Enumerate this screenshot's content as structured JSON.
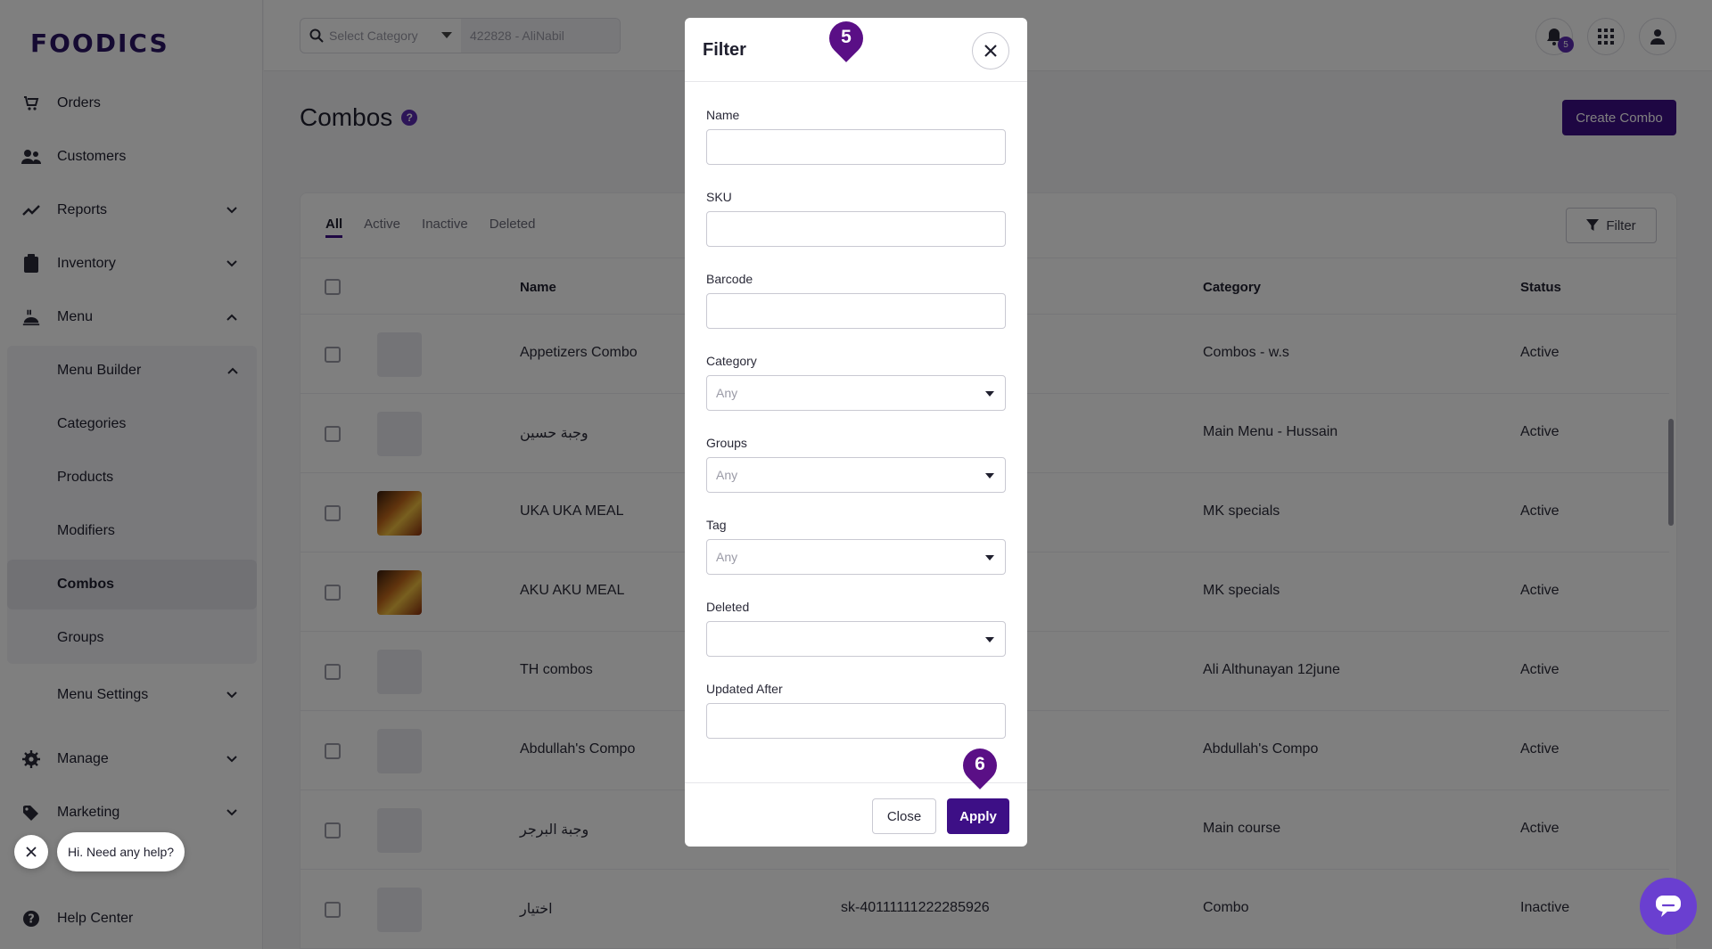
{
  "app": {
    "logo": "FOODICS"
  },
  "sidebar": {
    "items": [
      {
        "label": "Orders",
        "icon": "cart-icon"
      },
      {
        "label": "Customers",
        "icon": "users-icon"
      },
      {
        "label": "Reports",
        "icon": "chart-line-icon"
      },
      {
        "label": "Inventory",
        "icon": "clipboard-icon"
      },
      {
        "label": "Menu",
        "icon": "food-icon"
      }
    ],
    "menu_builder": {
      "label": "Menu Builder",
      "children": [
        "Categories",
        "Products",
        "Modifiers",
        "Combos",
        "Groups"
      ],
      "active": "Combos"
    },
    "menu_settings": "Menu Settings",
    "bottom_items": [
      {
        "label": "Manage",
        "icon": "gear-icon"
      },
      {
        "label": "Marketing",
        "icon": "tag-icon"
      },
      {
        "label": "Help Center",
        "icon": "question-icon"
      }
    ]
  },
  "topbar": {
    "category_placeholder": "Select Category",
    "branch_value": "422828 - AliNabil",
    "notification_count": "5"
  },
  "page": {
    "title": "Combos",
    "create_button": "Create Combo"
  },
  "tabs": [
    "All",
    "Active",
    "Inactive",
    "Deleted"
  ],
  "filter_button": "Filter",
  "table": {
    "headers": {
      "name": "Name",
      "category": "Category",
      "status": "Status"
    },
    "rows": [
      {
        "name": "Appetizers Combo",
        "sku": "",
        "category": "Combos - w.s",
        "status": "Active"
      },
      {
        "name": "وجبة حسين",
        "sku": "",
        "category": "Main Menu - Hussain",
        "status": "Active"
      },
      {
        "name": "UKA UKA MEAL",
        "sku": "",
        "category": "MK specials",
        "status": "Active"
      },
      {
        "name": "AKU AKU MEAL",
        "sku": "",
        "category": "MK specials",
        "status": "Active"
      },
      {
        "name": "TH combos",
        "sku": "",
        "category": "Ali Althunayan 12june",
        "status": "Active"
      },
      {
        "name": "Abdullah's Compo",
        "sku": "",
        "category": "Abdullah's Compo",
        "status": "Active"
      },
      {
        "name": "وجبة البرجر",
        "sku": "",
        "category": "Main course",
        "status": "Active"
      },
      {
        "name": "اختيار",
        "sku": "sk-40111111222285926",
        "category": "Combo",
        "status": "Inactive"
      }
    ]
  },
  "modal": {
    "title": "Filter",
    "fields": {
      "name": "Name",
      "sku": "SKU",
      "barcode": "Barcode",
      "category": "Category",
      "groups": "Groups",
      "tag": "Tag",
      "deleted": "Deleted",
      "updated_after": "Updated After"
    },
    "any_placeholder": "Any",
    "close_button": "Close",
    "apply_button": "Apply"
  },
  "markers": {
    "step_a": "5",
    "step_b": "6"
  },
  "help": {
    "bubble_text": "Hi. Need any help?"
  }
}
